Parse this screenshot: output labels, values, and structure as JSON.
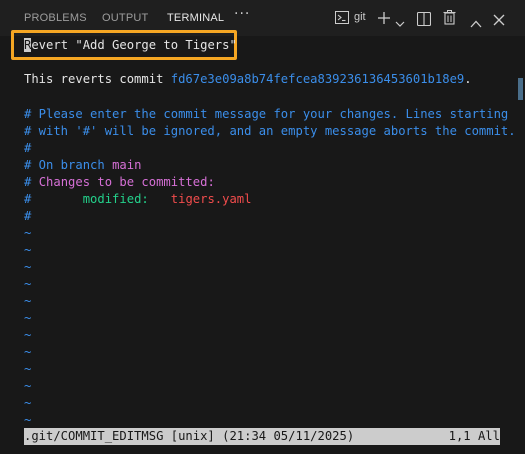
{
  "tabs": [
    {
      "label": "PROBLEMS",
      "active": false
    },
    {
      "label": "OUTPUT",
      "active": false
    },
    {
      "label": "TERMINAL",
      "active": true
    }
  ],
  "toolbar": {
    "more_icon": "ellipsis-icon",
    "terminal_icon": "terminal-icon",
    "terminal_name": "git",
    "add_icon": "plus-icon",
    "dropdown_icon": "chevron-down-icon",
    "split_icon": "split-icon",
    "trash_icon": "trash-icon",
    "maximize_icon": "chevron-up-icon",
    "close_icon": "close-icon"
  },
  "editor": {
    "title_cursor_char": "R",
    "title_rest": "evert \"Add George to Tigers\"",
    "reverts_prefix": "This reverts commit ",
    "commit_hash": "fd67e3e09a8b74fefcea839236136453601b18e9",
    "reverts_suffix": ".",
    "comment_lines": [
      "# Please enter the commit message for your changes. Lines starting",
      "# with '#' will be ignored, and an empty message aborts the commit.",
      "#"
    ],
    "branch_prefix": "# On branch ",
    "branch_name": "main",
    "changes_prefix": "# ",
    "changes_text": "Changes to be committed:",
    "modified_prefix": "#       ",
    "modified_label": "modified:",
    "modified_spacing": "   ",
    "modified_file": "tigers.yaml",
    "last_hash": "#",
    "tilde": "~"
  },
  "status": {
    "left": ".git/COMMIT_EDITMSG [unix] (21:34 05/11/2025)",
    "right": "1,1 All"
  },
  "colors": {
    "highlight_box": "#f5a623",
    "comment": "#3b8eea",
    "branch": "#d670d6",
    "modified": "#23d18b",
    "file": "#f14c4c"
  }
}
